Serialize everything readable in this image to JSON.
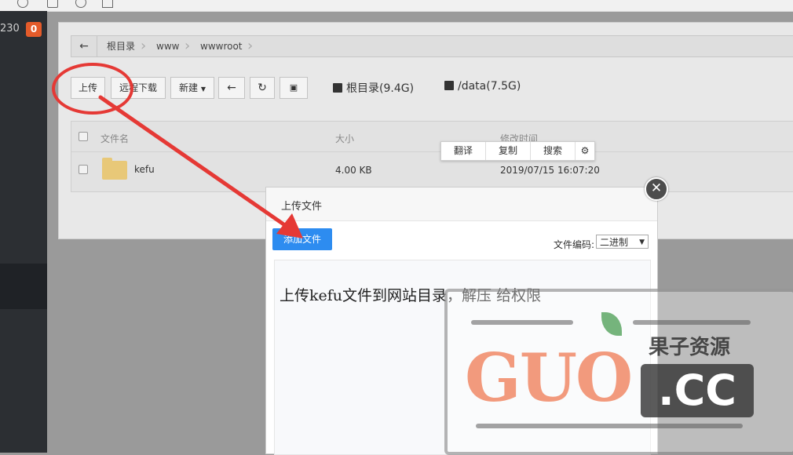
{
  "sidebar": {
    "count": "230",
    "badge": "0"
  },
  "breadcrumb": {
    "items": [
      "根目录",
      "www",
      "wwwroot"
    ]
  },
  "toolbar": {
    "upload": "上传",
    "remote_download": "远程下载",
    "new": "新建",
    "disks": [
      "根目录(9.4G)",
      "/data(7.5G)"
    ]
  },
  "table": {
    "headers": [
      "文件名",
      "大小",
      "修改时间"
    ],
    "rows": [
      {
        "name": "kefu",
        "size": "4.00 KB",
        "mtime": "2019/07/15 16:07:20"
      }
    ]
  },
  "context_menu": [
    "翻译",
    "复制",
    "搜索"
  ],
  "dialog": {
    "title": "上传文件",
    "add_file": "添加文件",
    "encoding_label": "文件编码:",
    "encoding_value": "二进制"
  },
  "annotation": "上传kefu文件到网站目录，解压 给权限",
  "watermark": {
    "brand": "GUO",
    "tld": ".CC",
    "name": "果子资源"
  },
  "colors": {
    "accent": "#2d8cf0",
    "badge": "#e45b2a",
    "annotation_red": "#e53935"
  }
}
